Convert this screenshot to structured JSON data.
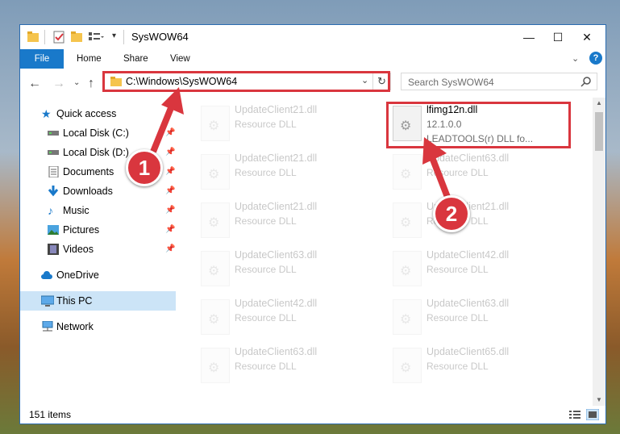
{
  "window": {
    "title": "SysWOW64",
    "controls": {
      "minimize": "—",
      "maximize": "☐",
      "close": "✕"
    }
  },
  "ribbon": {
    "tabs": [
      "File",
      "Home",
      "Share",
      "View"
    ],
    "help": "?"
  },
  "navbar": {
    "address": "C:\\Windows\\SysWOW64",
    "search_placeholder": "Search SysWOW64"
  },
  "sidebar": {
    "items": [
      {
        "label": "Quick access",
        "icon": "star-icon"
      },
      {
        "label": "Local Disk (C:)",
        "icon": "drive-icon",
        "pinned": true
      },
      {
        "label": "Local Disk (D:)",
        "icon": "drive-icon",
        "pinned": true
      },
      {
        "label": "Documents",
        "icon": "documents-icon",
        "pinned": true
      },
      {
        "label": "Downloads",
        "icon": "download-icon",
        "pinned": true
      },
      {
        "label": "Music",
        "icon": "music-icon",
        "pinned": true
      },
      {
        "label": "Pictures",
        "icon": "pictures-icon",
        "pinned": true
      },
      {
        "label": "Videos",
        "icon": "videos-icon",
        "pinned": true
      },
      {
        "label": "OneDrive",
        "icon": "cloud-icon"
      },
      {
        "label": "This PC",
        "icon": "computer-icon",
        "selected": true
      },
      {
        "label": "Network",
        "icon": "network-icon"
      }
    ]
  },
  "files": {
    "highlighted": {
      "name": "lfimg12n.dll",
      "version": "12.1.0.0",
      "description": "LEADTOOLS(r) DLL fo..."
    },
    "left_column": [
      {
        "name": "UpdateClient21.dll",
        "type": "Resource DLL"
      },
      {
        "name": "UpdateClient21.dll",
        "type": "Resource DLL"
      },
      {
        "name": "UpdateClient21.dll",
        "type": "Resource DLL"
      },
      {
        "name": "UpdateClient63.dll",
        "type": "Resource DLL"
      },
      {
        "name": "UpdateClient42.dll",
        "type": "Resource DLL"
      },
      {
        "name": "UpdateClient63.dll",
        "type": "Resource DLL"
      }
    ],
    "right_column": [
      {
        "name": "UpdateClient63.dll",
        "type": "Resource DLL"
      },
      {
        "name": "UpdateClient21.dll",
        "type": "Resource DLL"
      },
      {
        "name": "UpdateClient42.dll",
        "type": "Resource DLL"
      },
      {
        "name": "UpdateClient63.dll",
        "type": "Resource DLL"
      },
      {
        "name": "UpdateClient65.dll",
        "type": "Resource DLL"
      }
    ]
  },
  "status": {
    "item_count": "151 items"
  },
  "annotations": {
    "step1": "1",
    "step2": "2",
    "color": "#d9363e"
  }
}
